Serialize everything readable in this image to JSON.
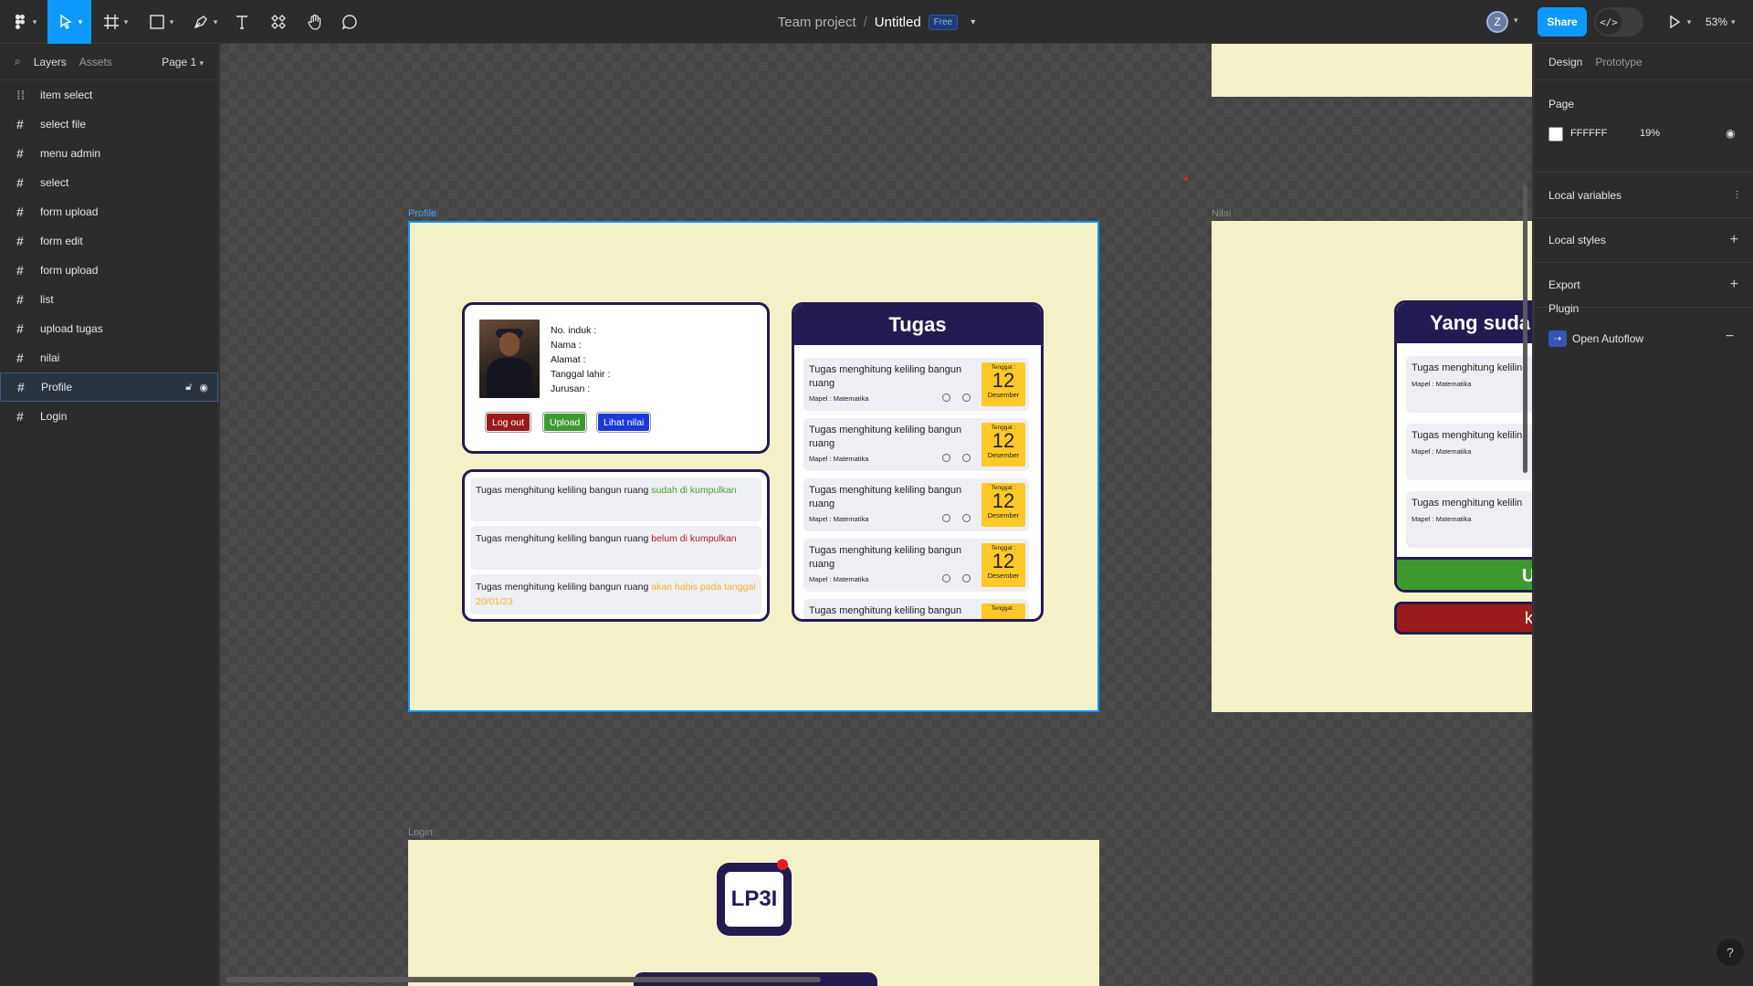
{
  "toolbar": {
    "breadcrumb_team": "Team project",
    "breadcrumb_sep": "/",
    "file_name": "Untitled",
    "plan_badge": "Free",
    "user_initial": "Z",
    "share_label": "Share",
    "devmode_icon": "</>",
    "zoom": "53%",
    "tools": [
      "figma-menu-icon",
      "move-icon",
      "frame-icon",
      "rectangle-icon",
      "pen-icon",
      "text-icon",
      "components-icon",
      "hand-icon",
      "comment-icon"
    ]
  },
  "left_panel": {
    "tab_layers": "Layers",
    "tab_assets": "Assets",
    "page_selector": "Page 1",
    "layers": [
      {
        "name": "item select",
        "kind": "dotted"
      },
      {
        "name": "select file",
        "kind": "frame"
      },
      {
        "name": "menu admin",
        "kind": "frame"
      },
      {
        "name": "select",
        "kind": "frame"
      },
      {
        "name": "form upload",
        "kind": "frame"
      },
      {
        "name": "form edit",
        "kind": "frame"
      },
      {
        "name": "form upload",
        "kind": "frame"
      },
      {
        "name": "list",
        "kind": "frame"
      },
      {
        "name": "upload tugas",
        "kind": "frame"
      },
      {
        "name": "nilai",
        "kind": "frame"
      },
      {
        "name": "Profile",
        "kind": "frame",
        "selected": true
      },
      {
        "name": "Login",
        "kind": "frame"
      }
    ]
  },
  "canvas": {
    "frame_labels": {
      "profile": "Profile",
      "nilai": "Nilai",
      "login": "Login"
    },
    "profile": {
      "info": [
        "No. induk :",
        "Nama :",
        "Alamat :",
        "Tanggal lahir :",
        "Jurusan :"
      ],
      "buttons": {
        "logout": "Log out",
        "upload": "Upload",
        "lihat": "Lihat nilai"
      },
      "status": [
        {
          "text": "Tugas menghitung keliling bangun ruang ",
          "status": "sudah di kumpulkan",
          "color": "#4aa02c"
        },
        {
          "text": "Tugas menghitung keliling bangun ruang ",
          "status": "belum di kumpulkan",
          "color": "#b01c1c"
        },
        {
          "text": "Tugas menghitung keliling bangun ruang ",
          "status": "akan habis pada tanggal 20/01/23",
          "color": "#f2b824"
        }
      ],
      "tugas_title": "Tugas",
      "tugas_items": [
        {
          "title": "Tugas menghitung keliling bangun ruang",
          "mapel": "Mapel : Matematika",
          "deadline_label": "Tenggat :",
          "day": "12",
          "month": "Desember"
        },
        {
          "title": "Tugas menghitung keliling bangun ruang",
          "mapel": "Mapel : Matematika",
          "deadline_label": "Tenggat :",
          "day": "12",
          "month": "Desember"
        },
        {
          "title": "Tugas menghitung keliling bangun ruang",
          "mapel": "Mapel : Matematika",
          "deadline_label": "Tenggat :",
          "day": "12",
          "month": "Desember"
        },
        {
          "title": "Tugas menghitung keliling bangun ruang",
          "mapel": "Mapel : Matematika",
          "deadline_label": "Tenggat :",
          "day": "12",
          "month": "Desember"
        },
        {
          "title": "Tugas menghitung keliling bangun",
          "mapel": "",
          "deadline_label": "Tenggat :",
          "day": "",
          "month": ""
        }
      ]
    },
    "nilai": {
      "title": "Yang suda",
      "items": [
        {
          "title": "Tugas menghitung kelilin",
          "mapel": "Mapel : Matematika"
        },
        {
          "title": "Tugas menghitung kelilin",
          "mapel": "Mapel : Matematika"
        },
        {
          "title": "Tugas menghitung kelilin",
          "mapel": "Mapel : Matematika"
        }
      ],
      "green_button": "U",
      "red_button": "k"
    },
    "login": {
      "logo_text": "LP3I"
    }
  },
  "right_panel": {
    "tab_design": "Design",
    "tab_prototype": "Prototype",
    "page_heading": "Page",
    "page_color": "FFFFFF",
    "page_opacity": "19%",
    "sections": [
      "Local variables",
      "Local styles",
      "Export",
      "Plugin"
    ],
    "plugin_name": "Open Autoflow",
    "help": "?"
  },
  "colors": {
    "accent": "#0d99ff",
    "frame_bg": "#f4f1c9",
    "navy": "#231a52",
    "logout": "#9b1b1b",
    "upload": "#3c9a2e",
    "lihat": "#1a3ad6",
    "deadline": "#ffc928"
  }
}
